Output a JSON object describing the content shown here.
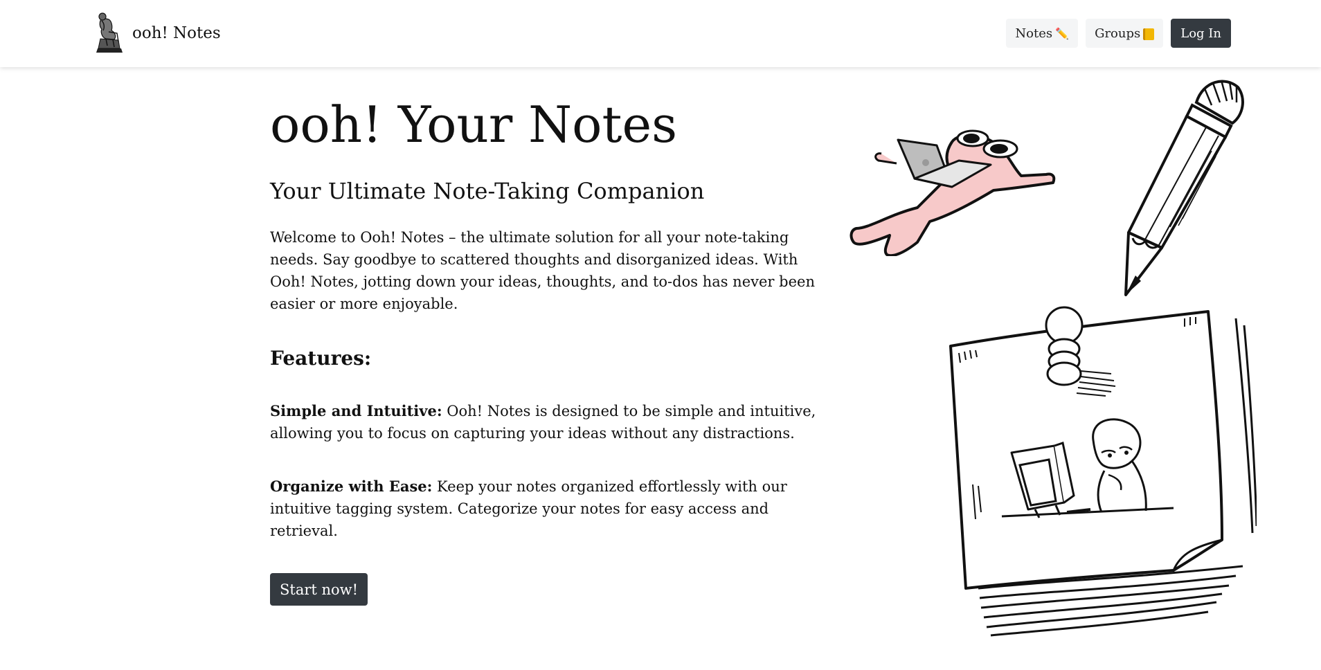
{
  "header": {
    "brand_name": "ooh! Notes",
    "nav": {
      "notes_label": "Notes",
      "notes_icon": "✏️",
      "groups_label": "Groups",
      "groups_icon": "notebook",
      "login_label": "Log In"
    }
  },
  "main": {
    "title": "ooh! Your Notes",
    "subtitle": "Your Ultimate Note-Taking Companion",
    "intro": "Welcome to Ooh! Notes – the ultimate solution for all your note-taking needs. Say goodbye to scattered thoughts and disorganized ideas. With Ooh! Notes, jotting down your ideas, thoughts, and to-dos has never been easier or more enjoyable.",
    "features_heading": "Features:",
    "features": [
      {
        "title": "Simple and Intuitive:",
        "text": " Ooh! Notes is designed to be simple and intuitive, allowing you to focus on capturing your ideas without any distractions."
      },
      {
        "title": "Organize with Ease:",
        "text": " Keep your notes organized effortlessly with our intuitive tagging system. Categorize your notes for easy access and retrieval."
      }
    ],
    "cta_label": "Start now!"
  },
  "colors": {
    "dark_button": "#343a40",
    "light_button": "#f4f5f6",
    "character_pink": "#f7c9c9"
  }
}
